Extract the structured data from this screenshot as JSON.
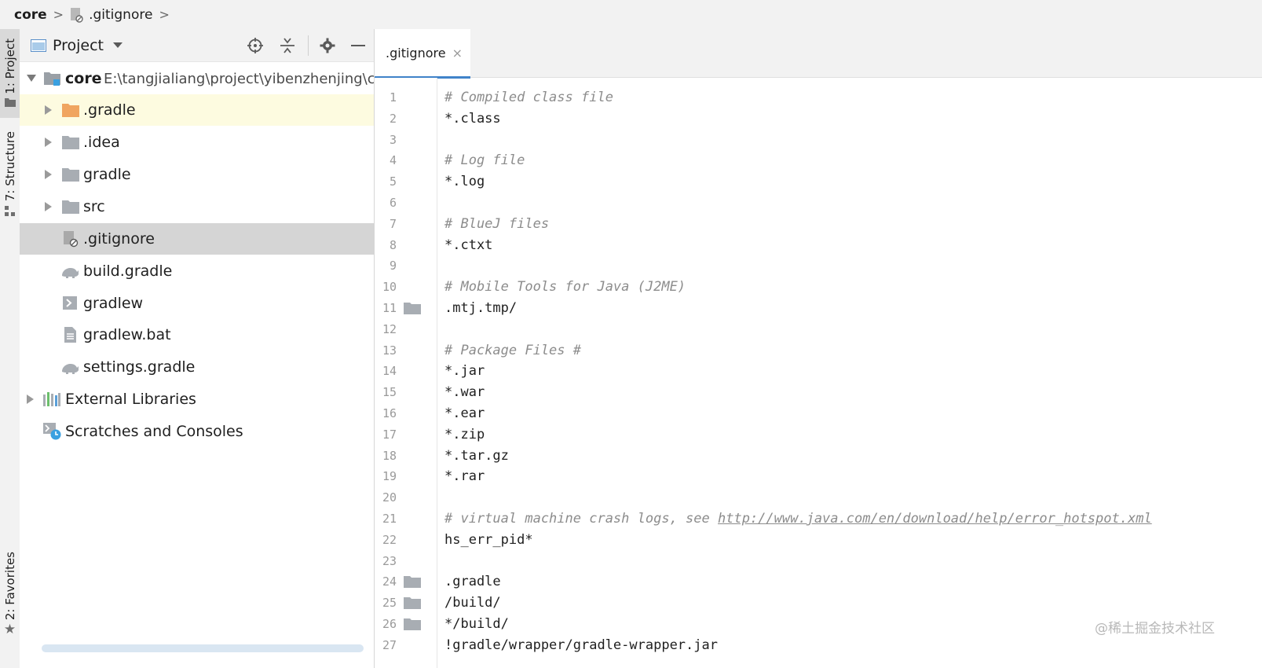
{
  "breadcrumb": {
    "project": "core",
    "file": ".gitignore"
  },
  "side_tabs": {
    "project": "1: Project",
    "structure": "7: Structure",
    "favorites": "2: Favorites"
  },
  "project_panel": {
    "title": "Project"
  },
  "tree": {
    "root": {
      "name": "core",
      "path": "E:\\tangjialiang\\project\\yibenzhenjing\\c"
    },
    "items": [
      {
        "label": ".gradle",
        "type": "folder-orange",
        "icon": "folder-icon"
      },
      {
        "label": ".idea",
        "type": "folder",
        "icon": "folder-icon"
      },
      {
        "label": "gradle",
        "type": "folder",
        "icon": "folder-icon"
      },
      {
        "label": "src",
        "type": "folder",
        "icon": "folder-icon"
      },
      {
        "label": ".gitignore",
        "type": "file",
        "icon": "gitignore-file-icon"
      },
      {
        "label": "build.gradle",
        "type": "file",
        "icon": "gradle-file-icon"
      },
      {
        "label": "gradlew",
        "type": "file",
        "icon": "shell-script-icon"
      },
      {
        "label": "gradlew.bat",
        "type": "file",
        "icon": "text-file-icon"
      },
      {
        "label": "settings.gradle",
        "type": "file",
        "icon": "gradle-file-icon"
      }
    ],
    "external_libraries": "External Libraries",
    "scratches": "Scratches and Consoles"
  },
  "editor": {
    "tab_label": ".gitignore",
    "tab_close": "×",
    "lines": [
      {
        "n": "1",
        "text": "# Compiled class file",
        "kind": "comment"
      },
      {
        "n": "2",
        "text": "*.class",
        "kind": "plain"
      },
      {
        "n": "3",
        "text": "",
        "kind": "plain"
      },
      {
        "n": "4",
        "text": "# Log file",
        "kind": "comment"
      },
      {
        "n": "5",
        "text": "*.log",
        "kind": "plain"
      },
      {
        "n": "6",
        "text": "",
        "kind": "plain"
      },
      {
        "n": "7",
        "text": "# BlueJ files",
        "kind": "comment"
      },
      {
        "n": "8",
        "text": "*.ctxt",
        "kind": "plain"
      },
      {
        "n": "9",
        "text": "",
        "kind": "plain"
      },
      {
        "n": "10",
        "text": "# Mobile Tools for Java (J2ME)",
        "kind": "comment"
      },
      {
        "n": "11",
        "text": ".mtj.tmp/",
        "kind": "plain",
        "folder": true
      },
      {
        "n": "12",
        "text": "",
        "kind": "plain"
      },
      {
        "n": "13",
        "text": "# Package Files #",
        "kind": "comment"
      },
      {
        "n": "14",
        "text": "*.jar",
        "kind": "plain"
      },
      {
        "n": "15",
        "text": "*.war",
        "kind": "plain"
      },
      {
        "n": "16",
        "text": "*.ear",
        "kind": "plain"
      },
      {
        "n": "17",
        "text": "*.zip",
        "kind": "plain"
      },
      {
        "n": "18",
        "text": "*.tar.gz",
        "kind": "plain"
      },
      {
        "n": "19",
        "text": "*.rar",
        "kind": "plain"
      },
      {
        "n": "20",
        "text": "",
        "kind": "plain"
      },
      {
        "n": "21",
        "text": "# virtual machine crash logs, see ",
        "kind": "comment",
        "link": "http://www.java.com/en/download/help/error_hotspot.xml"
      },
      {
        "n": "22",
        "text": "hs_err_pid*",
        "kind": "plain"
      },
      {
        "n": "23",
        "text": "",
        "kind": "plain"
      },
      {
        "n": "24",
        "text": ".gradle",
        "kind": "plain",
        "folder": true
      },
      {
        "n": "25",
        "text": "/build/",
        "kind": "plain",
        "folder": true
      },
      {
        "n": "26",
        "text": "*/build/",
        "kind": "plain",
        "folder": true
      },
      {
        "n": "27",
        "text": "!gradle/wrapper/gradle-wrapper.jar",
        "kind": "plain"
      }
    ]
  },
  "watermark": "@稀土掘金技术社区",
  "colors": {
    "accent": "#4083c9",
    "selection": "#d5d5d5",
    "highlight_row": "#fdfbe0",
    "folder_orange": "#f0a560"
  }
}
